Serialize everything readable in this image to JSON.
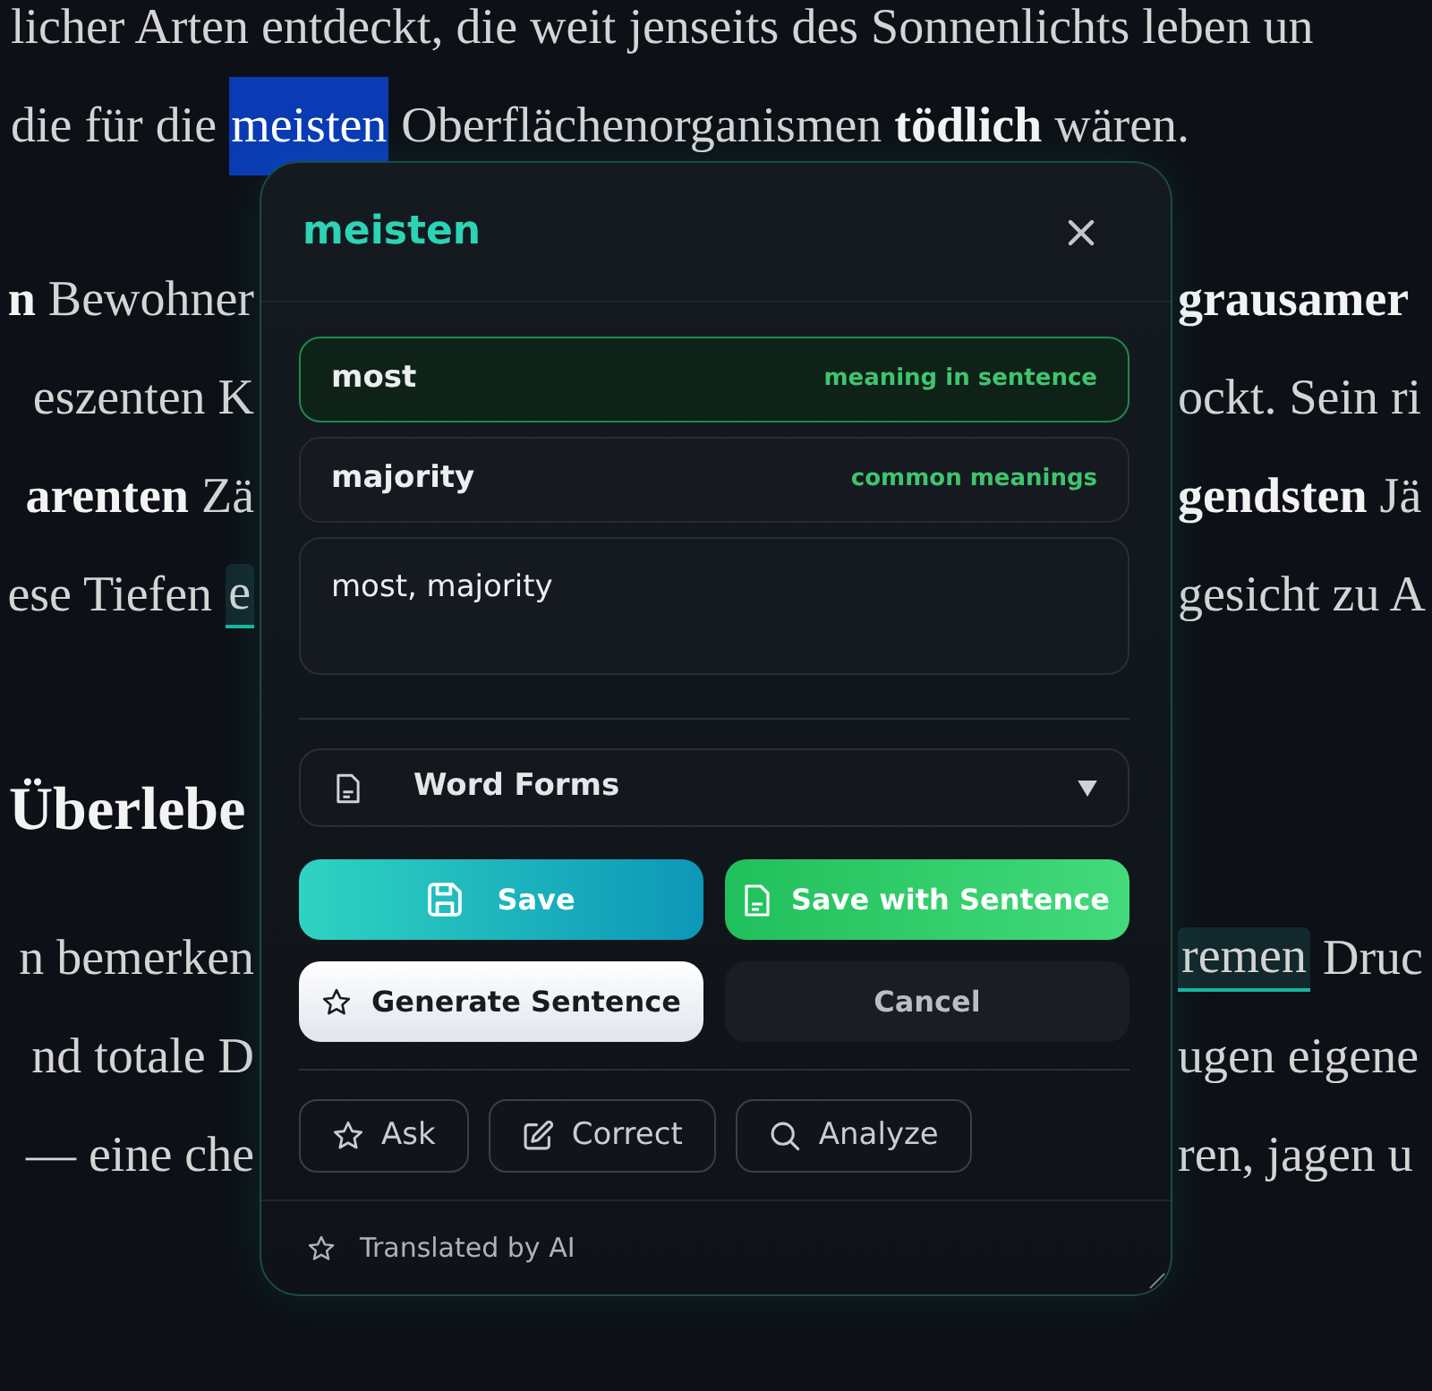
{
  "article": {
    "blocks": [
      {
        "kind": "paragraph",
        "lines": [
          {
            "left": [
              {
                "kind": "plain",
                "text": "licher Arten entdeckt, die weit jenseits des Sonnenlichts leben un"
              }
            ]
          },
          {
            "left": [
              {
                "kind": "plain",
                "text": "die für die"
              },
              {
                "kind": "selection",
                "text": "meisten"
              },
              {
                "kind": "plain",
                "text": "Oberflächenorganismen"
              },
              {
                "kind": "bold",
                "text": "tödlich"
              },
              {
                "kind": "plain",
                "text": "wären."
              }
            ]
          }
        ]
      },
      {
        "kind": "paragraph",
        "lines": [
          {
            "left": [
              {
                "kind": "bold",
                "text": "n"
              },
              {
                "kind": "plain",
                "text": "Bewohner"
              }
            ],
            "right": [
              {
                "kind": "bold",
                "text": "grausamer"
              }
            ]
          },
          {
            "left": [
              {
                "kind": "plain",
                "text": "eszenten K"
              }
            ],
            "right": [
              {
                "kind": "plain",
                "text": "ockt. Sein ri"
              }
            ]
          },
          {
            "left": [
              {
                "kind": "bold",
                "text": "arenten"
              },
              {
                "kind": "plain",
                "text": "Zä"
              }
            ],
            "right": [
              {
                "kind": "bold",
                "text": "gendsten"
              },
              {
                "kind": "plain",
                "text": "Jä"
              }
            ]
          },
          {
            "left": [
              {
                "kind": "plain",
                "text": "ese Tiefen"
              },
              {
                "kind": "saved",
                "text": "e"
              }
            ],
            "right": [
              {
                "kind": "plain",
                "text": "gesicht zu A"
              }
            ]
          }
        ]
      },
      {
        "kind": "heading",
        "text": "Überlebe"
      },
      {
        "kind": "paragraph",
        "lines": [
          {
            "left": [
              {
                "kind": "plain",
                "text": "n bemerken"
              }
            ],
            "right": [
              {
                "kind": "saved",
                "text": "remen"
              },
              {
                "kind": "plain",
                "text": "Druc"
              }
            ]
          },
          {
            "left": [
              {
                "kind": "plain",
                "text": "nd totale D"
              }
            ],
            "right": [
              {
                "kind": "plain",
                "text": "ugen eigene"
              }
            ]
          },
          {
            "left": [
              {
                "kind": "plain",
                "text": "— eine che"
              }
            ],
            "right": [
              {
                "kind": "plain",
                "text": "ren, jagen u"
              }
            ]
          }
        ]
      }
    ]
  },
  "popup": {
    "title": "meisten",
    "meanings": [
      {
        "text": "most",
        "tag": "meaning in sentence",
        "selected": true
      },
      {
        "text": "majority",
        "tag": "common meanings",
        "selected": false
      }
    ],
    "translation": {
      "value": "most, majority"
    },
    "dropdown": {
      "label": "Word Forms"
    },
    "actions": [
      {
        "kind": "save",
        "label": "Save"
      },
      {
        "kind": "save_sentence",
        "label": "Save with Sentence"
      },
      {
        "kind": "generate",
        "label": "Generate Sentence"
      },
      {
        "kind": "cancel",
        "label": "Cancel"
      }
    ],
    "tools": [
      {
        "kind": "ask",
        "label": "Ask"
      },
      {
        "kind": "correct",
        "label": "Correct"
      },
      {
        "kind": "analyze",
        "label": "Analyze"
      }
    ],
    "footer": {
      "text": "Translated by AI"
    }
  }
}
